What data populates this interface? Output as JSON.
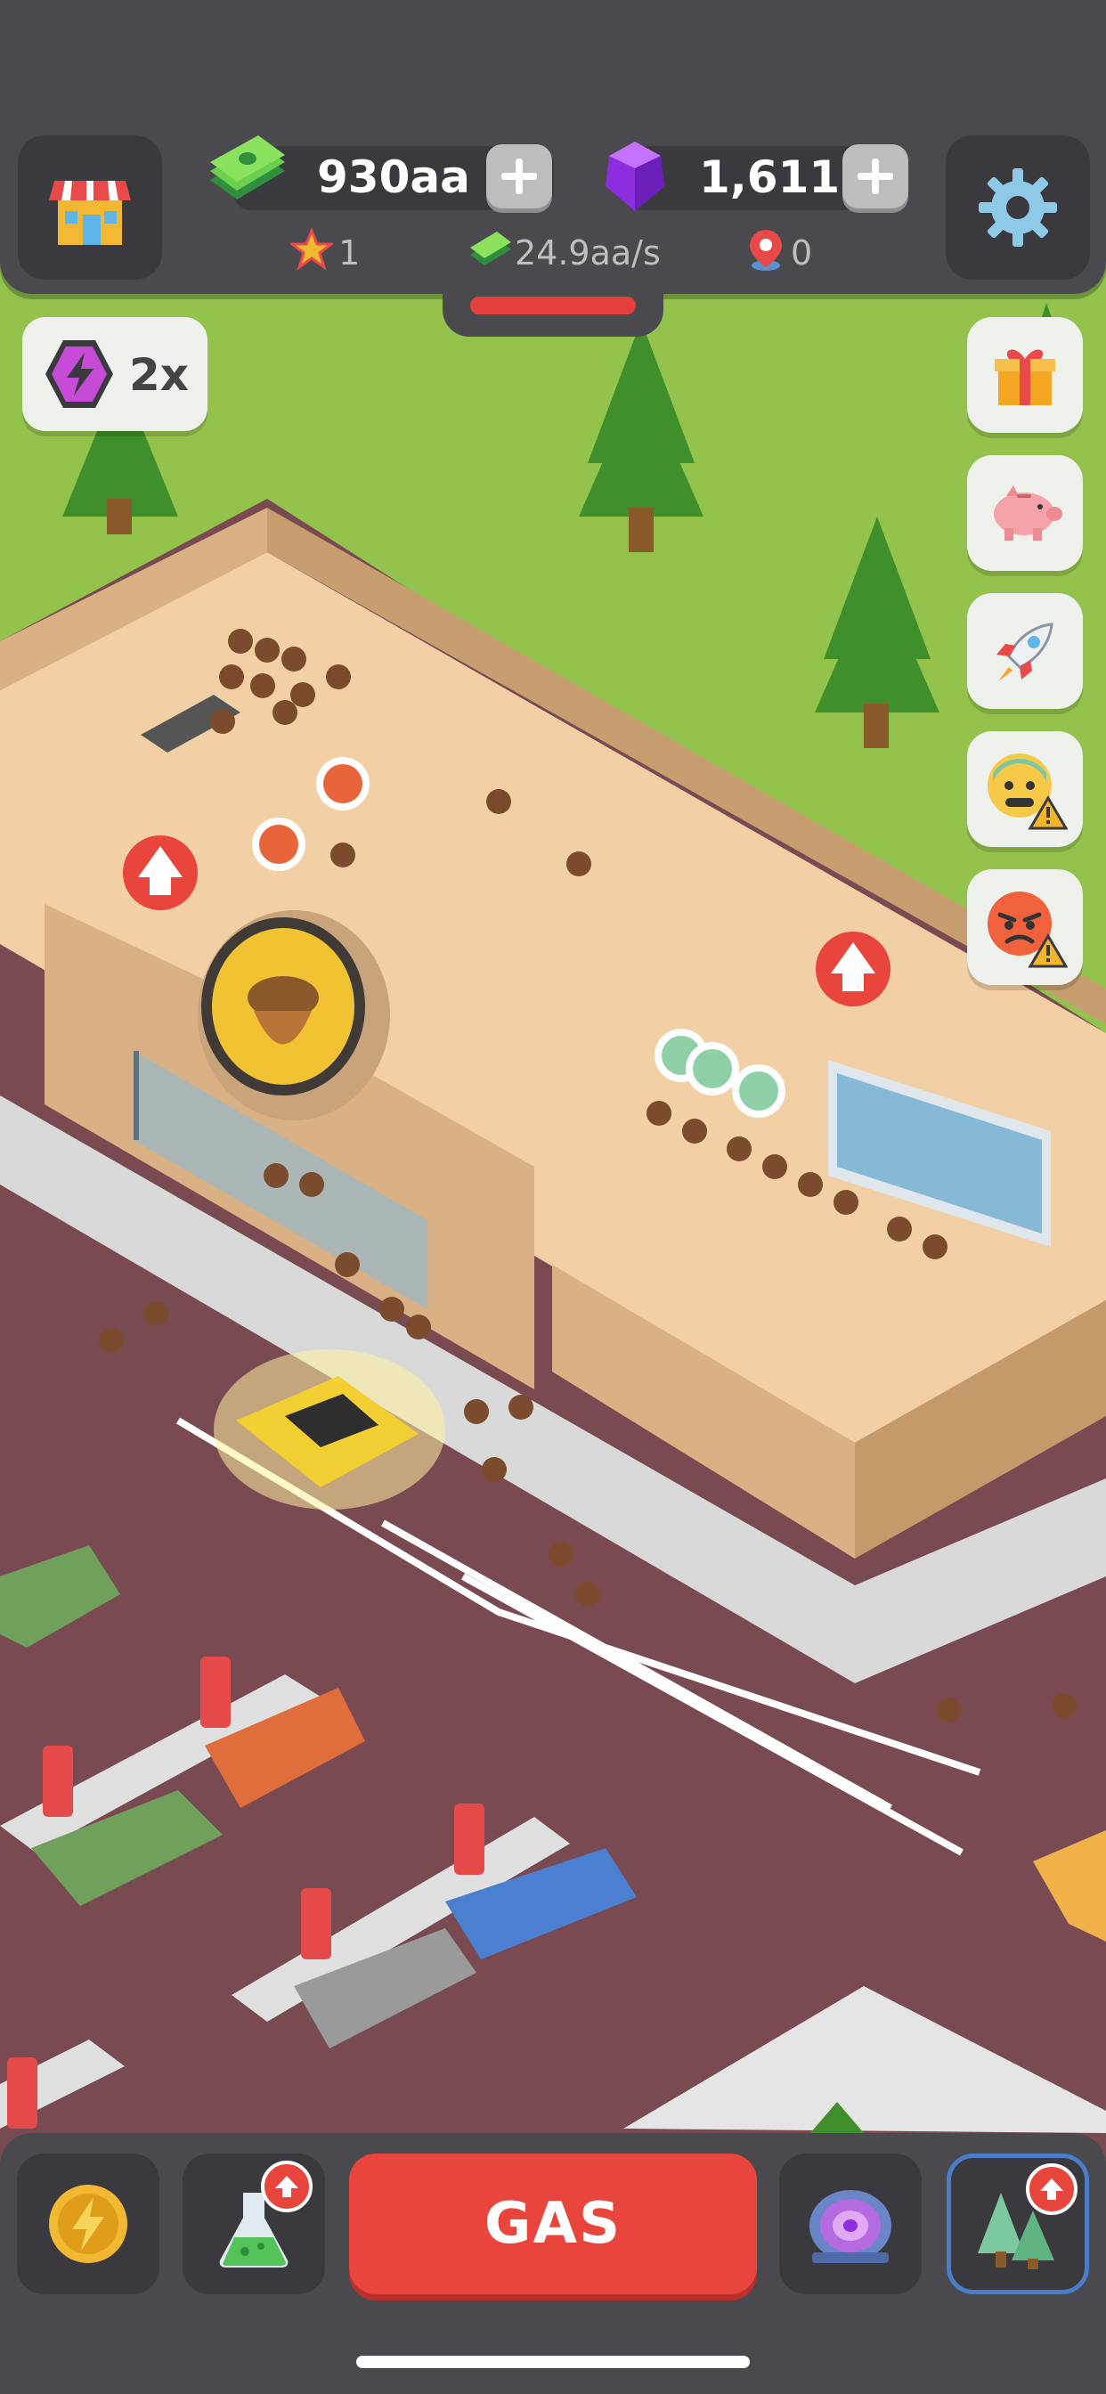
{
  "hud": {
    "cash_value": "930aa",
    "gems_value": "1,611",
    "stars_value": "1",
    "income_rate": "24.9aa/s",
    "location_value": "0",
    "icons": [
      "shop-icon",
      "cash-icon",
      "gem-icon",
      "settings-icon",
      "star-icon",
      "location-pin-icon"
    ]
  },
  "boost": {
    "multiplier": "2x",
    "icon": "lightning-hexagon-icon"
  },
  "side_buttons": [
    "gift-icon",
    "piggy-bank-icon",
    "rocket-icon",
    "anxious-face-warning-icon",
    "angry-face-warning-icon"
  ],
  "bottom_bar": {
    "gas_label": "GAS",
    "buttons": [
      "lightning-coin-icon",
      "research-flask-icon",
      "portal-icon",
      "trees-upgrade-icon"
    ]
  },
  "colors": {
    "hud_bg": "#4a4a4e",
    "accent_red": "#e8453c",
    "grass": "#93c34d",
    "asphalt": "#7a4a52",
    "store_floor": "#f2cfa5"
  }
}
